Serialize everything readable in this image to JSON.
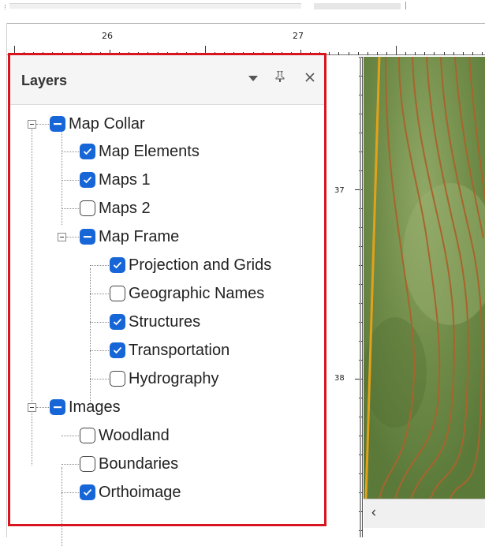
{
  "ruler": {
    "h_labels": [
      "26",
      "27"
    ],
    "v_labels": [
      "37",
      "38"
    ]
  },
  "panel": {
    "title": "Layers"
  },
  "tree": [
    {
      "id": "map-collar",
      "label": "Map Collar",
      "state": "partial",
      "expanded": true
    },
    {
      "id": "map-elements",
      "label": "Map Elements",
      "state": "checked"
    },
    {
      "id": "maps-1",
      "label": "Maps 1",
      "state": "checked"
    },
    {
      "id": "maps-2",
      "label": "Maps 2",
      "state": "unchecked"
    },
    {
      "id": "map-frame",
      "label": "Map Frame",
      "state": "partial",
      "expanded": true
    },
    {
      "id": "projection-grids",
      "label": "Projection and Grids",
      "state": "checked"
    },
    {
      "id": "geographic-names",
      "label": "Geographic Names",
      "state": "unchecked"
    },
    {
      "id": "structures",
      "label": "Structures",
      "state": "checked"
    },
    {
      "id": "transportation",
      "label": "Transportation",
      "state": "checked"
    },
    {
      "id": "hydrography",
      "label": "Hydrography",
      "state": "unchecked"
    },
    {
      "id": "images",
      "label": "Images",
      "state": "partial",
      "expanded": true
    },
    {
      "id": "woodland",
      "label": "Woodland",
      "state": "unchecked"
    },
    {
      "id": "boundaries",
      "label": "Boundaries",
      "state": "unchecked"
    },
    {
      "id": "orthoimage",
      "label": "Orthoimage",
      "state": "checked"
    }
  ],
  "colors": {
    "highlight_border": "#d8141e",
    "checkbox_blue": "#1766d8"
  },
  "icons": {
    "menu": "dropdown-arrow-icon",
    "pin": "pin-icon",
    "close": "close-icon",
    "scroll_left": "scroll-left-arrow-icon"
  }
}
